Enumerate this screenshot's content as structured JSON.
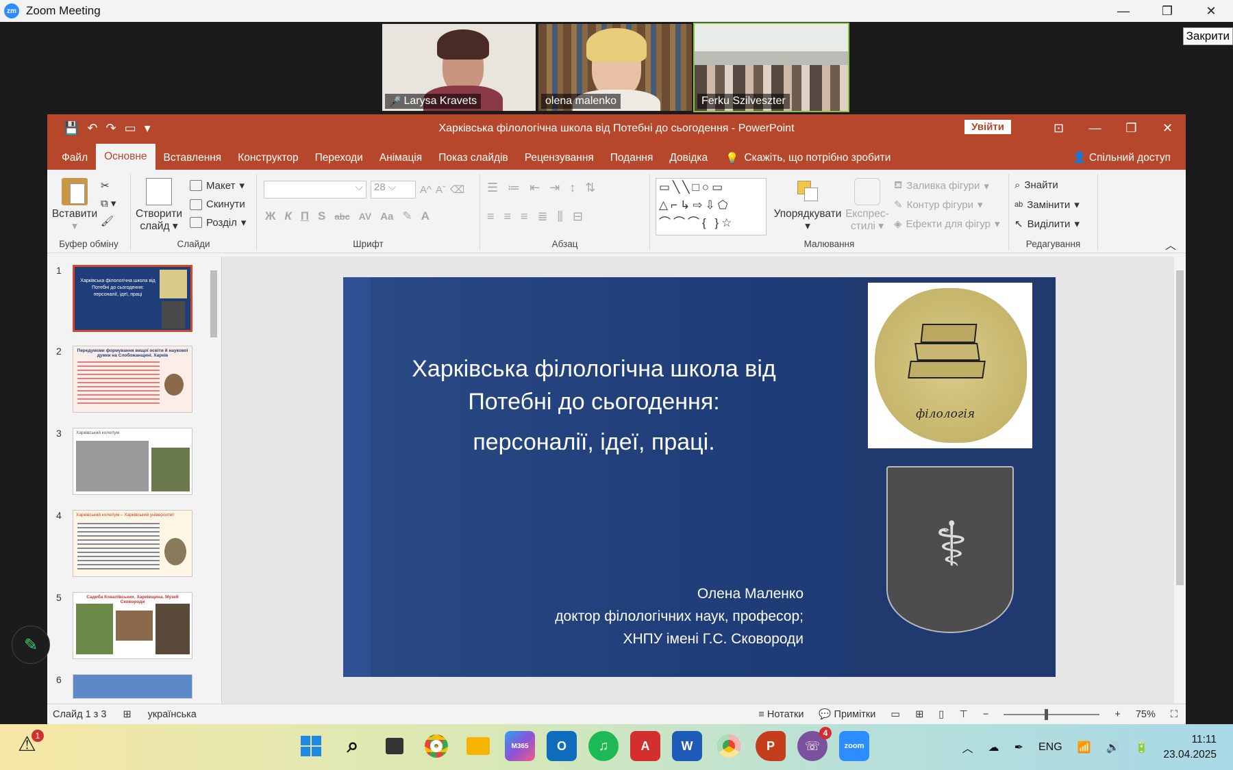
{
  "zoom": {
    "window_title": "Zoom Meeting",
    "logo_text": "zm",
    "controls": [
      "—",
      "❐",
      "✕"
    ],
    "close_tooltip": "Закрити",
    "participants": [
      {
        "name": "Larysa Kravets",
        "muted": true
      },
      {
        "name": "olena malenko",
        "muted": false
      },
      {
        "name": "Ferku Szilveszter",
        "muted": false
      }
    ]
  },
  "ppt": {
    "title": "Харківська філологічна школа від Потебні до сьогодення  -  PowerPoint",
    "signin_label": "Увійти",
    "tabs": [
      "Файл",
      "Основне",
      "Вставлення",
      "Конструктор",
      "Переходи",
      "Анімація",
      "Показ слайдів",
      "Рецензування",
      "Подання",
      "Довідка"
    ],
    "active_tab": "Основне",
    "tell_me": "Скажіть, що потрібно зробити",
    "share": "Спільний доступ",
    "ribbon": {
      "clipboard": {
        "paste": "Вставити",
        "label": "Буфер обміну"
      },
      "slides": {
        "new_slide_1": "Створити",
        "new_slide_2": "слайд",
        "layout": "Макет",
        "reset": "Скинути",
        "section": "Розділ",
        "label": "Слайди"
      },
      "font": {
        "size": "28",
        "label": "Шрифт",
        "bold": "Ж",
        "italic": "К",
        "underline": "П",
        "shadow": "S",
        "strike": "abc",
        "spacing": "AV",
        "case": "Aa"
      },
      "paragraph": {
        "label": "Абзац"
      },
      "drawing": {
        "arrange": "Упорядкувати",
        "quick_styles_1": "Експрес-",
        "quick_styles_2": "стилі",
        "fill": "Заливка фігури",
        "outline": "Контур фігури",
        "effects": "Ефекти для фігур",
        "label": "Малювання"
      },
      "editing": {
        "find": "Знайти",
        "replace": "Замінити",
        "select": "Виділити",
        "label": "Редагування"
      }
    },
    "thumbnails": [
      {
        "num": "1",
        "text": "Харківська філологічна школа від Потебні до сьогодення: персоналії, ідеї, праці"
      },
      {
        "num": "2",
        "text": "Передумови формування вищої освіти й наукової думки на Слобожанщині. Харків"
      },
      {
        "num": "3",
        "text": "Харківський колегіум"
      },
      {
        "num": "4",
        "text": "Харківський колегіум – Харківський університет"
      },
      {
        "num": "5",
        "text": "Садиба Ковалівських. Харківщина. Музей Сковороди"
      },
      {
        "num": "6",
        "text": ""
      }
    ],
    "slide": {
      "title_line1": "Харківська філологічна школа від",
      "title_line2": "Потебні до сьогодення:",
      "subtitle": "персоналії, ідеї, праці.",
      "author": "Олена Маленко",
      "degree": "доктор філологічних наук, професор;",
      "university": "ХНПУ імені Г.С. Сковороди",
      "image_caption": "філологія"
    },
    "status": {
      "slide_info": "Слайд 1 з 3",
      "language": "українська",
      "notes": "Нотатки",
      "comments": "Примітки",
      "zoom": "75%"
    }
  },
  "taskbar": {
    "weather_badge": "1",
    "apps": [
      {
        "name": "windows-start",
        "label": "",
        "color": "#1e88e5"
      },
      {
        "name": "search",
        "label": "",
        "color": "transparent"
      },
      {
        "name": "task-view",
        "label": "",
        "color": "transparent"
      },
      {
        "name": "chrome",
        "label": "",
        "color": "#34a853"
      },
      {
        "name": "file-explorer",
        "label": "",
        "color": "#f4b400"
      },
      {
        "name": "m365",
        "label": "M365",
        "color": "#5c6bc0"
      },
      {
        "name": "outlook",
        "label": "O",
        "color": "#0f6cbd"
      },
      {
        "name": "spotify",
        "label": "♫",
        "color": "#1db954"
      },
      {
        "name": "acrobat",
        "label": "A",
        "color": "#d32f2f"
      },
      {
        "name": "word",
        "label": "W",
        "color": "#1e5bb8"
      },
      {
        "name": "chrome-profile",
        "label": "",
        "color": "#34a853"
      },
      {
        "name": "powerpoint",
        "label": "P",
        "color": "#c43e1c"
      },
      {
        "name": "viber",
        "label": "☏",
        "color": "#7b519d"
      },
      {
        "name": "zoom",
        "label": "zoom",
        "color": "#2d8cff"
      }
    ],
    "viber_badge": "4",
    "language": "ENG",
    "time": "11:11",
    "date": "23.04.2025"
  }
}
